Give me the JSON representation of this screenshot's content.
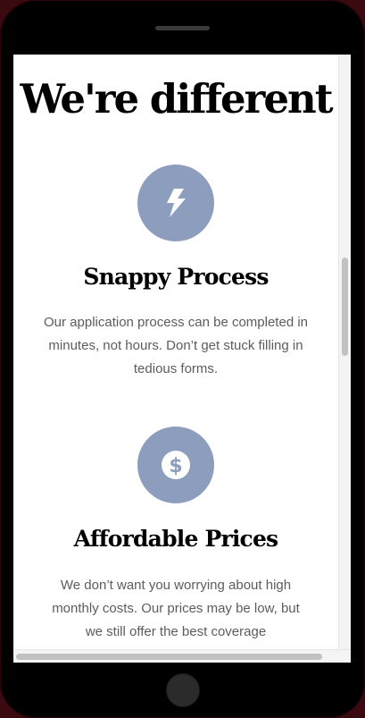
{
  "page": {
    "title": "We're different"
  },
  "features": [
    {
      "icon": "lightning-bolt-icon",
      "title": "Snappy Process",
      "text": "Our application process can be completed in minutes, not hours. Don’t get stuck filling in tedious forms."
    },
    {
      "icon": "dollar-coin-icon",
      "title": "Affordable Prices",
      "text": "We don’t want you worrying about high monthly costs. Our prices may be low, but we still offer the best coverage"
    }
  ],
  "colors": {
    "icon_circle": "#8c9dbe",
    "body_text": "#5c5c5c",
    "heading": "#000000"
  }
}
